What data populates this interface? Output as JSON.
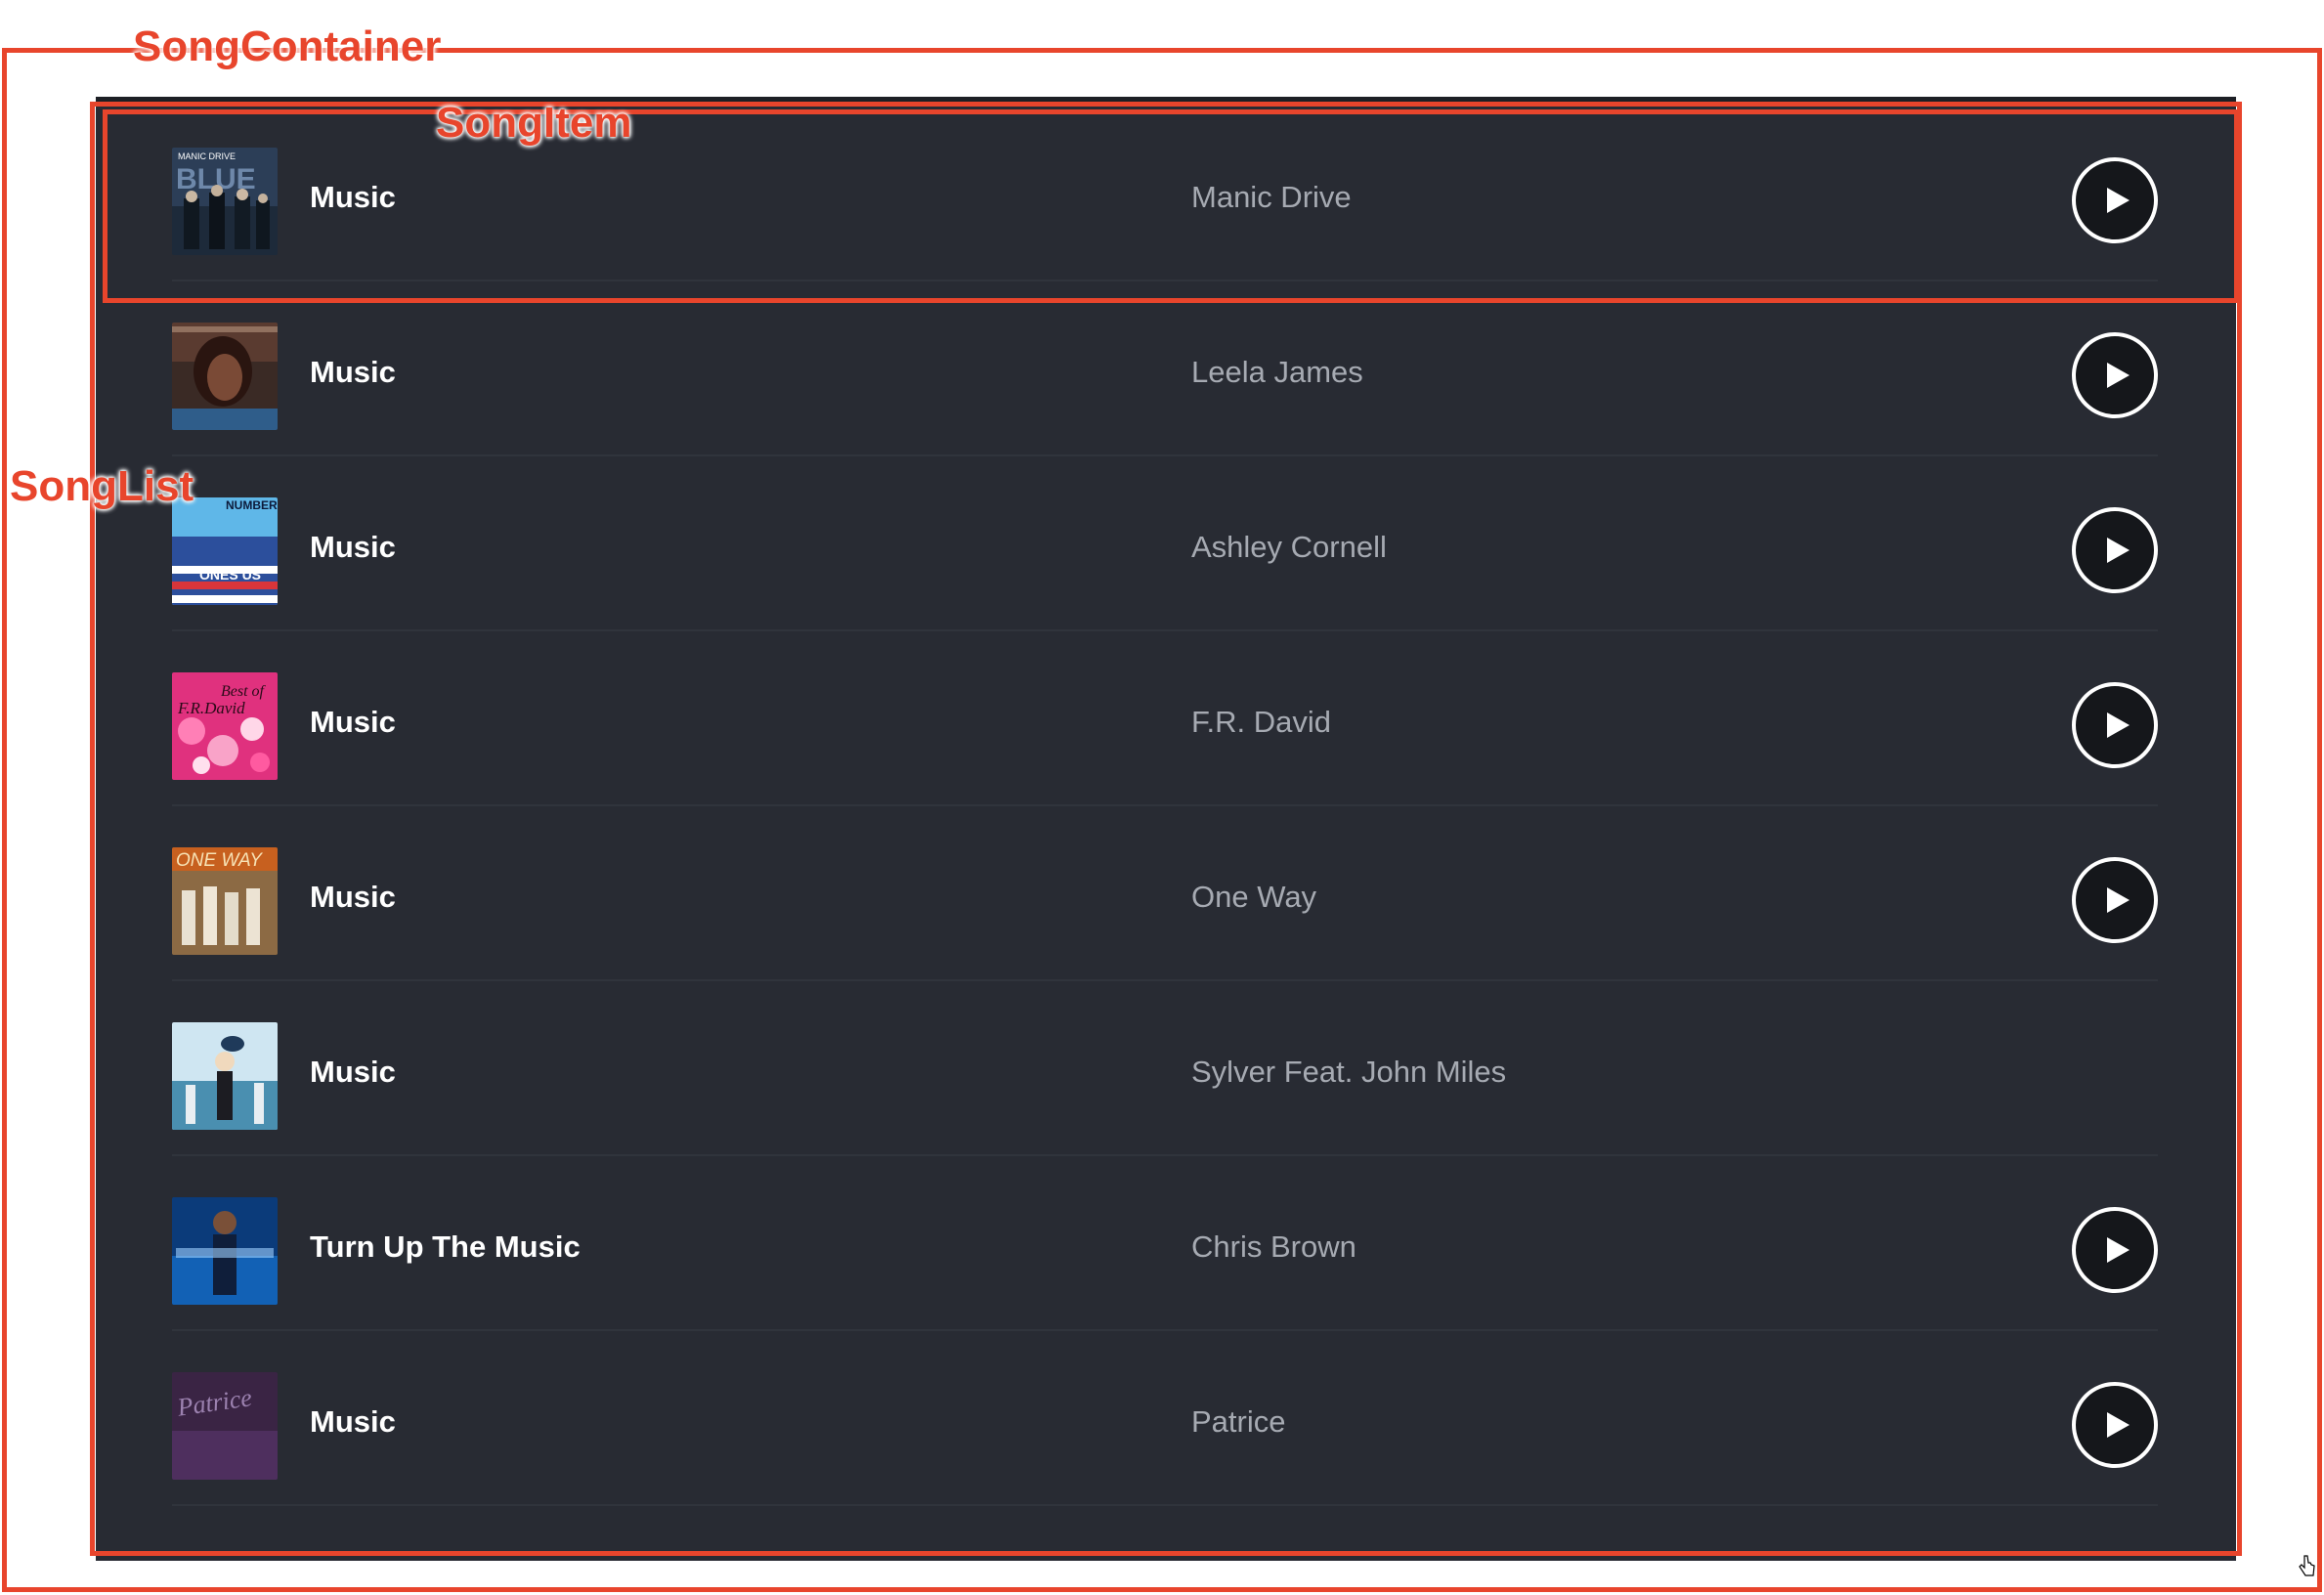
{
  "annotations": {
    "song_container_label": "SongContainer",
    "song_item_label": "SongItem",
    "song_list_label": "SongList",
    "color": "#e8452c"
  },
  "songs": [
    {
      "title": "Music",
      "artist": "Manic Drive",
      "cover_text": "MANIC DRIVE BLUE",
      "has_play": true
    },
    {
      "title": "Music",
      "artist": "Leela James",
      "cover_text": "",
      "has_play": true
    },
    {
      "title": "Music",
      "artist": "Ashley Cornell",
      "cover_text": "NUMBER ONES US",
      "has_play": true
    },
    {
      "title": "Music",
      "artist": "F.R. David",
      "cover_text": "Best of F.R. David",
      "has_play": true
    },
    {
      "title": "Music",
      "artist": "One Way",
      "cover_text": "ONE WAY",
      "has_play": true
    },
    {
      "title": "Music",
      "artist": "Sylver Feat. John Miles",
      "cover_text": "",
      "has_play": false
    },
    {
      "title": "Turn Up The Music",
      "artist": "Chris Brown",
      "cover_text": "",
      "has_play": true
    },
    {
      "title": "Music",
      "artist": "Patrice",
      "cover_text": "Patrice",
      "has_play": true
    }
  ],
  "icons": {
    "play": "play-icon"
  },
  "colors": {
    "panel_bg": "#282b33",
    "title_text": "#ffffff",
    "artist_text": "#a6aab2",
    "play_button_bg": "#15171b",
    "annotation": "#e8452c"
  }
}
